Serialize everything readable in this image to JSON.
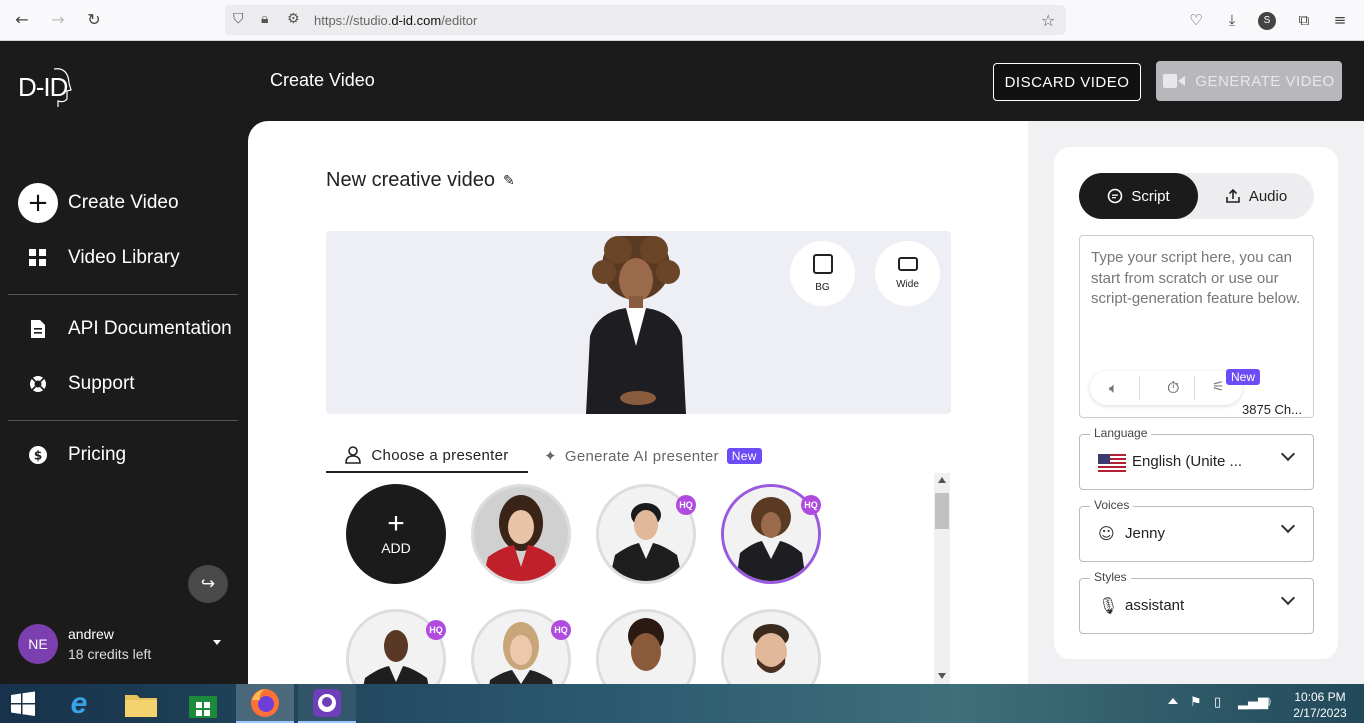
{
  "browser": {
    "url_host_prefix": "https://studio.",
    "url_host_main": "d-id.com",
    "url_path": "/editor",
    "profile_initial": "S"
  },
  "sidebar": {
    "logo": "D-ID",
    "items": [
      {
        "label": "Create Video",
        "icon": "plus-circle-icon"
      },
      {
        "label": "Video Library",
        "icon": "grid-icon"
      },
      {
        "label": "API Documentation",
        "icon": "document-icon"
      },
      {
        "label": "Support",
        "icon": "lifebuoy-icon"
      },
      {
        "label": "Pricing",
        "icon": "dollar-icon"
      }
    ],
    "user": {
      "initials": "NE",
      "name": "andrew",
      "credits": "18 credits left"
    }
  },
  "topbar": {
    "title": "Create Video",
    "discard_label": "DISCARD VIDEO",
    "generate_label": "GENERATE VIDEO"
  },
  "editor": {
    "video_title": "New creative video",
    "preview_buttons": {
      "bg": "BG",
      "wide": "Wide"
    },
    "tabs": {
      "choose": "Choose a presenter",
      "generate": "Generate AI presenter",
      "new_badge": "New"
    },
    "add_label": "ADD",
    "hq_label": "HQ"
  },
  "script_panel": {
    "tab_script": "Script",
    "tab_audio": "Audio",
    "placeholder": "Type your script here, you can start from scratch or use our script-generation feature below.",
    "new_badge": "New",
    "char_count": "3875 Ch...",
    "language_label": "Language",
    "language_value": "English (Unite ...",
    "voices_label": "Voices",
    "voices_value": "Jenny",
    "styles_label": "Styles",
    "styles_value": "assistant"
  },
  "taskbar": {
    "time": "10:06 PM",
    "date": "2/17/2023"
  },
  "colors": {
    "accent_purple": "#6c4cf5",
    "hq_purple": "#b04be0",
    "dark": "#1b1b1b",
    "avatar_circle": "#7b3fb0"
  }
}
